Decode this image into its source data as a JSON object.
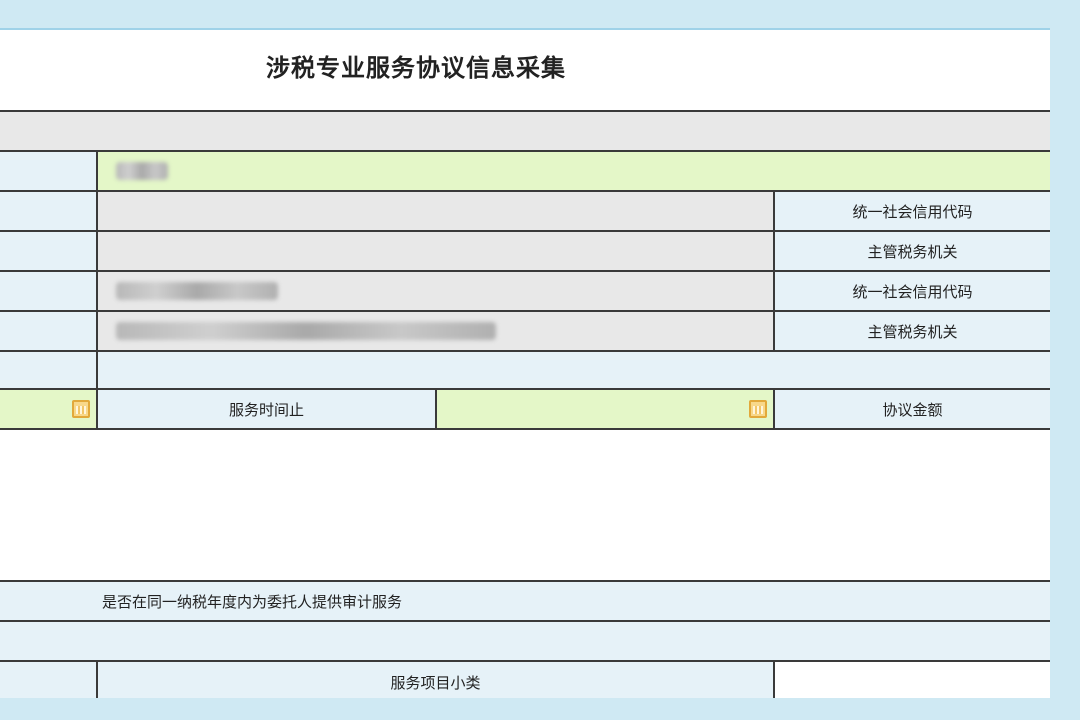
{
  "form": {
    "title": "涉税专业服务协议信息采集",
    "labels": {
      "credit_code_1": "统一社会信用代码",
      "tax_authority_1": "主管税务机关",
      "credit_code_2": "统一社会信用代码",
      "tax_authority_2": "主管税务机关",
      "service_end": "服务时间止",
      "agreement_amount": "协议金额",
      "audit_question": "是否在同一纳税年度内为委托人提供审计服务",
      "service_subcategory": "服务项目小类"
    }
  },
  "icons": {
    "calendar": "calendar-icon"
  },
  "colors": {
    "page_bg": "#cfe9f3",
    "label_bg": "#e6f2f8",
    "readonly_bg": "#e8e8e8",
    "editable_bg": "#e4f7c8",
    "border": "#3a3a3a",
    "calendar": "#e2a93a"
  }
}
